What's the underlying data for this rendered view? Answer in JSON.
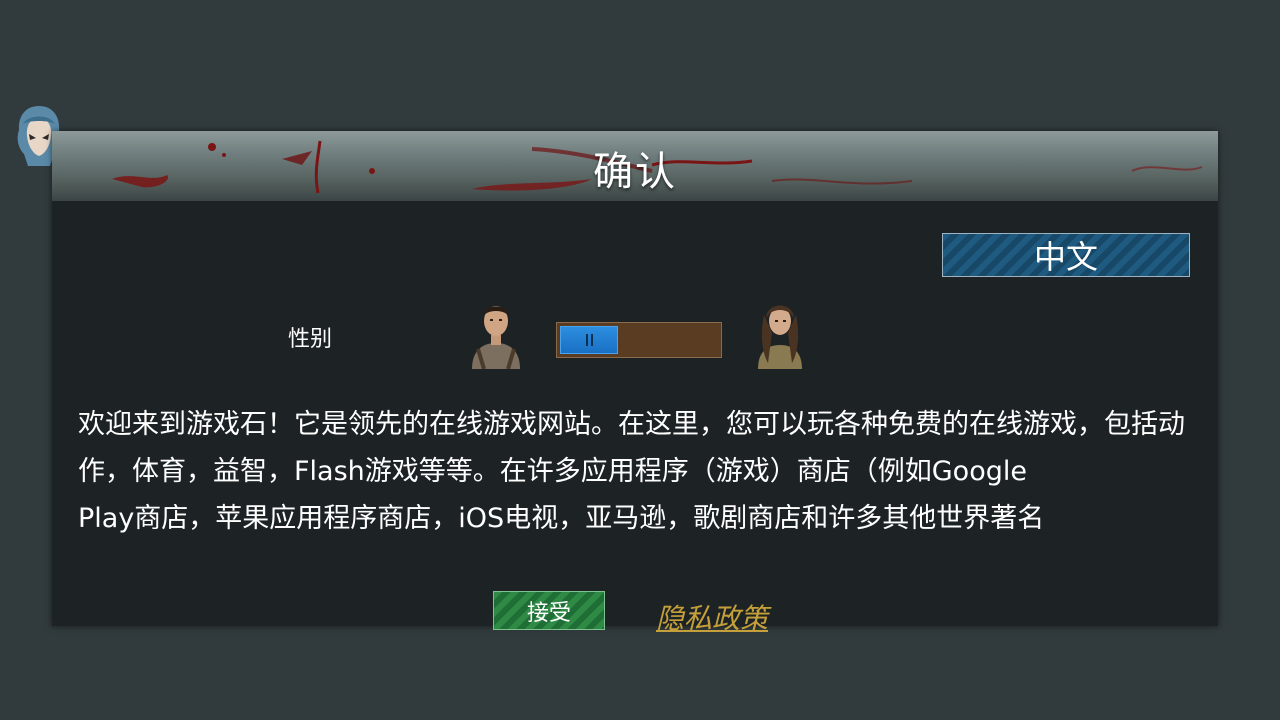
{
  "dialog": {
    "title": "确认",
    "language_button": "中文",
    "gender": {
      "label": "性别",
      "selected": "male"
    },
    "body_text": "欢迎来到游戏石！它是领先的在线游戏网站。在这里，您可以玩各种免费的在线游戏，包括动作，体育，益智，Flash游戏等等。在许多应用程序（游戏）商店（例如Google\nPlay商店，苹果应用程序商店，iOS电视，亚马逊，歌剧商店和许多其他世界著名",
    "accept_button": "接受",
    "privacy_link": "隐私政策"
  },
  "icons": {
    "avatar": "hooded-character-avatar-icon",
    "male": "male-character-portrait",
    "female": "female-character-portrait",
    "toggle_grip": "grip-icon"
  },
  "colors": {
    "background": "#313a3c",
    "dialog": "#1d2325",
    "language_button": "#1f5b80",
    "toggle_knob": "#1970c4",
    "toggle_track": "#5a3c22",
    "accept_button": "#2f8a46",
    "privacy_link": "#c5a03a"
  }
}
